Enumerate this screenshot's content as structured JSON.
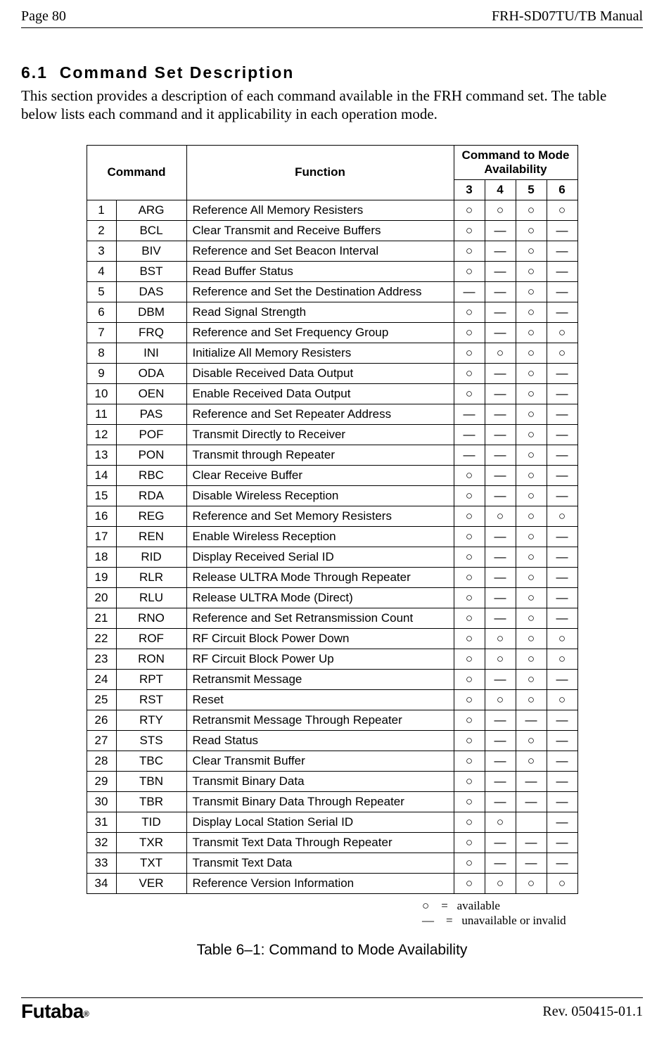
{
  "header": {
    "page_label": "Page  80",
    "manual_title": "FRH-SD07TU/TB Manual"
  },
  "section": {
    "number": "6.1",
    "title": "Command Set Description"
  },
  "intro": "This section provides a description of each command available in the FRH command set. The table below lists each command and it applicability in each operation mode.",
  "table": {
    "headers": {
      "command": "Command",
      "function": "Function",
      "availability": "Command to Mode Availability",
      "modes": [
        "3",
        "4",
        "5",
        "6"
      ]
    },
    "rows": [
      {
        "n": "1",
        "cmd": "ARG",
        "fn": "Reference All Memory Resisters",
        "a": [
          "○",
          "○",
          "○",
          "○"
        ]
      },
      {
        "n": "2",
        "cmd": "BCL",
        "fn": "Clear Transmit and Receive Buffers",
        "a": [
          "○",
          "―",
          "○",
          "―"
        ]
      },
      {
        "n": "3",
        "cmd": "BIV",
        "fn": "Reference and Set Beacon Interval",
        "a": [
          "○",
          "―",
          "○",
          "―"
        ]
      },
      {
        "n": "4",
        "cmd": "BST",
        "fn": "Read Buffer Status",
        "a": [
          "○",
          "―",
          "○",
          "―"
        ]
      },
      {
        "n": "5",
        "cmd": "DAS",
        "fn": "Reference and Set the Destination Address",
        "a": [
          "―",
          "―",
          "○",
          "―"
        ]
      },
      {
        "n": "6",
        "cmd": "DBM",
        "fn": "Read Signal Strength",
        "a": [
          "○",
          "―",
          "○",
          "―"
        ]
      },
      {
        "n": "7",
        "cmd": "FRQ",
        "fn": "Reference and Set Frequency Group",
        "a": [
          "○",
          "―",
          "○",
          "○"
        ]
      },
      {
        "n": "8",
        "cmd": "INI",
        "fn": "Initialize All Memory Resisters",
        "a": [
          "○",
          "○",
          "○",
          "○"
        ]
      },
      {
        "n": "9",
        "cmd": "ODA",
        "fn": "Disable Received Data Output",
        "a": [
          "○",
          "―",
          "○",
          "―"
        ]
      },
      {
        "n": "10",
        "cmd": "OEN",
        "fn": "Enable Received Data Output",
        "a": [
          "○",
          "―",
          "○",
          "―"
        ]
      },
      {
        "n": "11",
        "cmd": "PAS",
        "fn": "Reference and Set Repeater Address",
        "a": [
          "―",
          "―",
          "○",
          "―"
        ]
      },
      {
        "n": "12",
        "cmd": "POF",
        "fn": "Transmit Directly to Receiver",
        "a": [
          "―",
          "―",
          "○",
          "―"
        ]
      },
      {
        "n": "13",
        "cmd": "PON",
        "fn": "Transmit through Repeater",
        "a": [
          "―",
          "―",
          "○",
          "―"
        ]
      },
      {
        "n": "14",
        "cmd": "RBC",
        "fn": "Clear Receive Buffer",
        "a": [
          "○",
          "―",
          "○",
          "―"
        ]
      },
      {
        "n": "15",
        "cmd": "RDA",
        "fn": "Disable Wireless Reception",
        "a": [
          "○",
          "―",
          "○",
          "―"
        ]
      },
      {
        "n": "16",
        "cmd": "REG",
        "fn": "Reference and Set Memory Resisters",
        "a": [
          "○",
          "○",
          "○",
          "○"
        ]
      },
      {
        "n": "17",
        "cmd": "REN",
        "fn": "Enable Wireless Reception",
        "a": [
          "○",
          "―",
          "○",
          "―"
        ]
      },
      {
        "n": "18",
        "cmd": "RID",
        "fn": "Display Received Serial ID",
        "a": [
          "○",
          "―",
          "○",
          "―"
        ]
      },
      {
        "n": "19",
        "cmd": "RLR",
        "fn": "Release ULTRA Mode Through Repeater",
        "a": [
          "○",
          "―",
          "○",
          "―"
        ]
      },
      {
        "n": "20",
        "cmd": "RLU",
        "fn": "Release ULTRA Mode (Direct)",
        "a": [
          "○",
          "―",
          "○",
          "―"
        ]
      },
      {
        "n": "21",
        "cmd": "RNO",
        "fn": "Reference and Set Retransmission Count",
        "a": [
          "○",
          "―",
          "○",
          "―"
        ]
      },
      {
        "n": "22",
        "cmd": "ROF",
        "fn": "RF Circuit Block Power Down",
        "a": [
          "○",
          "○",
          "○",
          "○"
        ]
      },
      {
        "n": "23",
        "cmd": "RON",
        "fn": "RF Circuit Block Power Up",
        "a": [
          "○",
          "○",
          "○",
          "○"
        ]
      },
      {
        "n": "24",
        "cmd": "RPT",
        "fn": "Retransmit Message",
        "a": [
          "○",
          "―",
          "○",
          "―"
        ]
      },
      {
        "n": "25",
        "cmd": "RST",
        "fn": "Reset",
        "a": [
          "○",
          "○",
          "○",
          "○"
        ]
      },
      {
        "n": "26",
        "cmd": "RTY",
        "fn": "Retransmit Message Through Repeater",
        "a": [
          "○",
          "―",
          "―",
          "―"
        ]
      },
      {
        "n": "27",
        "cmd": "STS",
        "fn": "Read Status",
        "a": [
          "○",
          "―",
          "○",
          "―"
        ]
      },
      {
        "n": "28",
        "cmd": "TBC",
        "fn": "Clear Transmit Buffer",
        "a": [
          "○",
          "―",
          "○",
          "―"
        ]
      },
      {
        "n": "29",
        "cmd": "TBN",
        "fn": "Transmit Binary Data",
        "a": [
          "○",
          "―",
          "―",
          "―"
        ]
      },
      {
        "n": "30",
        "cmd": "TBR",
        "fn": "Transmit Binary Data Through Repeater",
        "a": [
          "○",
          "―",
          "―",
          "―"
        ]
      },
      {
        "n": "31",
        "cmd": "TID",
        "fn": "Display Local Station Serial ID",
        "a": [
          "○",
          "○",
          "",
          "―"
        ]
      },
      {
        "n": "32",
        "cmd": "TXR",
        "fn": "Transmit Text Data Through Repeater",
        "a": [
          "○",
          "―",
          "―",
          "―"
        ]
      },
      {
        "n": "33",
        "cmd": "TXT",
        "fn": "Transmit Text Data",
        "a": [
          "○",
          "―",
          "―",
          "―"
        ]
      },
      {
        "n": "34",
        "cmd": "VER",
        "fn": "Reference Version Information",
        "a": [
          "○",
          "○",
          "○",
          "○"
        ]
      }
    ]
  },
  "legend": {
    "available": "○    =   available",
    "unavailable": "―    =   unavailable or invalid"
  },
  "caption": "Table 6–1:  Command to Mode Availability",
  "footer": {
    "logo": "Futaba",
    "rev": "Rev. 050415-01.1"
  }
}
